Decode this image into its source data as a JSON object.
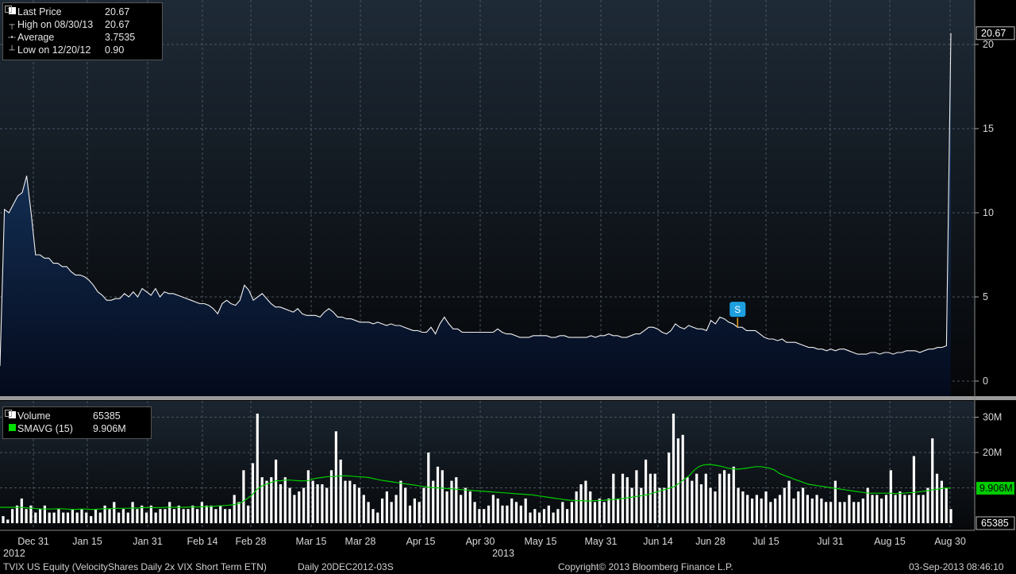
{
  "chart_data": {
    "type": "area",
    "security": "TVIX US Equity (VelocityShares Daily 2x VIX Short Term ETN)",
    "period_info": "Daily 20DEC2012-03S",
    "copyright": "Copyright© 2013 Bloomberg Finance L.P.",
    "timestamp": "03-Sep-2013 08:46:10",
    "year_labels": [
      "2012",
      "2013"
    ],
    "x_tick_labels": [
      "Dec 31",
      "Jan 15",
      "Jan 31",
      "Feb 14",
      "Feb 28",
      "Mar 15",
      "Mar 28",
      "Apr 15",
      "Apr 30",
      "May 15",
      "May 31",
      "Jun 14",
      "Jun 28",
      "Jul 15",
      "Jul 31",
      "Aug 15",
      "Aug 30"
    ],
    "price_panel": {
      "ylim": [
        0,
        22
      ],
      "y_ticks": [
        "0",
        "5",
        "10",
        "15",
        "20"
      ],
      "last_price_tag": "20.67",
      "legend": [
        {
          "label": "Last Price",
          "value": "20.67",
          "symbol": "square"
        },
        {
          "label": "High on 08/30/13",
          "value": "20.67",
          "symbol": "high"
        },
        {
          "label": "Average",
          "value": "3.7535",
          "symbol": "avg"
        },
        {
          "label": "Low on 12/20/12",
          "value": "0.90",
          "symbol": "low"
        }
      ],
      "annotation": {
        "text": "S",
        "date_index": 166
      },
      "series": [
        {
          "name": "Last Price",
          "color": "#f0f0f0",
          "fill_top": "#1b3f6b",
          "values": [
            0.9,
            10.2,
            10.0,
            10.5,
            11.0,
            11.2,
            12.2,
            10.0,
            7.5,
            7.5,
            7.3,
            7.3,
            7.0,
            7.0,
            6.8,
            6.8,
            6.5,
            6.3,
            6.3,
            6.2,
            6.0,
            5.7,
            5.3,
            5.1,
            4.8,
            4.8,
            4.9,
            4.9,
            5.2,
            5.0,
            5.3,
            5.0,
            5.5,
            5.3,
            5.1,
            5.5,
            5.0,
            5.3,
            5.2,
            5.2,
            5.1,
            5.0,
            4.9,
            4.8,
            4.7,
            4.6,
            4.6,
            4.5,
            4.3,
            4.0,
            4.6,
            4.8,
            4.6,
            4.5,
            4.8,
            5.7,
            5.4,
            4.8,
            5.0,
            5.2,
            4.9,
            4.6,
            4.4,
            4.4,
            4.3,
            4.2,
            4.1,
            4.3,
            4.0,
            3.9,
            3.9,
            3.9,
            3.8,
            4.1,
            4.3,
            4.1,
            3.8,
            3.8,
            3.7,
            3.7,
            3.6,
            3.5,
            3.5,
            3.5,
            3.4,
            3.5,
            3.4,
            3.3,
            3.4,
            3.3,
            3.3,
            3.2,
            3.1,
            3.0,
            3.0,
            2.9,
            2.9,
            3.2,
            2.8,
            3.4,
            3.8,
            3.4,
            3.1,
            3.1,
            2.9,
            2.9,
            2.9,
            2.9,
            2.9,
            2.9,
            2.9,
            2.9,
            3.1,
            2.9,
            2.8,
            2.8,
            2.7,
            2.6,
            2.6,
            2.6,
            2.7,
            2.7,
            2.7,
            2.7,
            2.6,
            2.6,
            2.7,
            2.7,
            2.6,
            2.6,
            2.6,
            2.6,
            2.6,
            2.7,
            2.6,
            2.7,
            2.7,
            2.8,
            2.7,
            2.7,
            2.6,
            2.6,
            2.7,
            2.8,
            2.8,
            3.0,
            3.2,
            3.2,
            3.1,
            2.9,
            2.8,
            3.0,
            3.4,
            3.2,
            3.1,
            3.3,
            3.2,
            3.1,
            3.1,
            3.0,
            3.6,
            3.4,
            3.8,
            3.7,
            3.5,
            3.4,
            3.2,
            3.2,
            3.0,
            3.0,
            3.0,
            2.8,
            2.6,
            2.5,
            2.5,
            2.4,
            2.5,
            2.3,
            2.3,
            2.3,
            2.2,
            2.1,
            2.0,
            2.0,
            1.9,
            1.9,
            1.8,
            1.9,
            1.8,
            1.9,
            1.9,
            1.8,
            1.7,
            1.6,
            1.6,
            1.6,
            1.7,
            1.7,
            1.6,
            1.7,
            1.7,
            1.6,
            1.7,
            1.7,
            1.8,
            1.8,
            1.8,
            1.7,
            1.8,
            1.9,
            1.9,
            2.0,
            2.0,
            2.1,
            20.67
          ]
        }
      ]
    },
    "volume_panel": {
      "ylim": [
        0,
        32
      ],
      "unit": "M",
      "y_ticks": [
        "30M",
        "20M"
      ],
      "sma_tag": "9.906M",
      "volume_tag": "65385",
      "legend": [
        {
          "label": "Volume",
          "value": "65385",
          "color": "#ffffff"
        },
        {
          "label": "SMAVG (15)",
          "value": "9.906M",
          "color": "#00dd00"
        }
      ],
      "series": [
        {
          "name": "Volume",
          "color": "#ffffff",
          "values": [
            2,
            1,
            4,
            5,
            7,
            4,
            5,
            3,
            4,
            5,
            3,
            3,
            4,
            3,
            3,
            4,
            3,
            4,
            3,
            2,
            4,
            3,
            5,
            4,
            6,
            3,
            4,
            3,
            6,
            4,
            5,
            3,
            5,
            3,
            4,
            4,
            6,
            4,
            5,
            4,
            4,
            5,
            4,
            6,
            5,
            5,
            4,
            5,
            4,
            4,
            8,
            6,
            15,
            5,
            17,
            31,
            13,
            12,
            13,
            18,
            11,
            13,
            10,
            8,
            9,
            10,
            15,
            12,
            11,
            11,
            10,
            15,
            26,
            18,
            12,
            12,
            11,
            10,
            8,
            6,
            4,
            3,
            7,
            9,
            6,
            8,
            12,
            10,
            5,
            7,
            6,
            10,
            20,
            12,
            16,
            15,
            9,
            12,
            13,
            8,
            10,
            9,
            6,
            4,
            4,
            5,
            8,
            7,
            5,
            5,
            7,
            6,
            5,
            7,
            3,
            4,
            3,
            4,
            5,
            3,
            4,
            6,
            4,
            6,
            9,
            11,
            12,
            9,
            6,
            7,
            6,
            7,
            14,
            7,
            14,
            13,
            10,
            15,
            10,
            18,
            14,
            14,
            10,
            10,
            20,
            31,
            24,
            25,
            13,
            12,
            14,
            11,
            14,
            10,
            9,
            14,
            15,
            14,
            16,
            10,
            9,
            8,
            7,
            8,
            7,
            9,
            6,
            7,
            8,
            10,
            12,
            7,
            9,
            10,
            8,
            7,
            8,
            7,
            6,
            6,
            12,
            6,
            6,
            8,
            6,
            6,
            7,
            10,
            8,
            8,
            7,
            8,
            15,
            8,
            9,
            8,
            8,
            19,
            8,
            8,
            10,
            24,
            14,
            12,
            10,
            4
          ]
        },
        {
          "name": "SMAVG (15)",
          "color": "#00cc00",
          "values": [
            4.5,
            4.5,
            4.5,
            4.5,
            4.5,
            4.4,
            4.3,
            4.2,
            4.1,
            4.0,
            4.0,
            4.0,
            4.1,
            4.1,
            4.0,
            3.9,
            3.9,
            4.0,
            4.0,
            3.9,
            3.9,
            4.0,
            4.1,
            4.1,
            4.2,
            4.2,
            4.2,
            4.2,
            4.3,
            4.3,
            4.4,
            4.4,
            4.4,
            4.4,
            4.4,
            4.5,
            4.5,
            4.5,
            4.5,
            4.5,
            4.6,
            4.6,
            4.6,
            4.7,
            4.7,
            4.8,
            4.9,
            5.0,
            5.1,
            5.2,
            5.5,
            6.0,
            7.0,
            8.0,
            9.5,
            10.5,
            11.0,
            11.5,
            12.0,
            12.0,
            12.2,
            12.2,
            12.1,
            12.0,
            12.0,
            12.1,
            12.6,
            12.8,
            13.0,
            13.2,
            13.2,
            13.3,
            13.4,
            13.4,
            13.3,
            13.2,
            13.1,
            13.0,
            12.8,
            12.5,
            12.2,
            12.0,
            11.8,
            11.6,
            11.4,
            11.2,
            11.0,
            10.8,
            10.6,
            10.4,
            10.2,
            10.1,
            10.0,
            9.9,
            9.8,
            9.7,
            9.6,
            9.5,
            9.4,
            9.3,
            9.2,
            9.1,
            9.0,
            8.9,
            8.8,
            8.7,
            8.6,
            8.5,
            8.4,
            8.3,
            8.2,
            8.1,
            8.0,
            7.8,
            7.6,
            7.4,
            7.2,
            7.0,
            6.8,
            6.6,
            6.5,
            6.4,
            6.4,
            6.3,
            6.3,
            6.4,
            6.4,
            6.5,
            6.6,
            6.7,
            6.8,
            7.0,
            7.2,
            7.4,
            7.6,
            7.8,
            8.0,
            8.4,
            8.8,
            9.2,
            9.6,
            10.0,
            10.5,
            11.5,
            12.5,
            13.5,
            15.0,
            16.0,
            16.5,
            16.6,
            16.5,
            16.3,
            16.0,
            15.6,
            15.4,
            15.3,
            15.4,
            15.6,
            15.8,
            16.0,
            16.0,
            15.8,
            15.5,
            15.0,
            14.0,
            13.5,
            13.0,
            12.5,
            12.0,
            11.5,
            11.0,
            10.8,
            10.6,
            10.4,
            10.2,
            10.0,
            9.8,
            9.6,
            9.4,
            9.2,
            9.0,
            8.8,
            8.6,
            8.5,
            8.5,
            8.5,
            8.5,
            8.5,
            8.4,
            8.4,
            8.5,
            8.6,
            8.7,
            8.8,
            9.0,
            9.2,
            9.4,
            9.6,
            9.8,
            10.0,
            9.906
          ]
        }
      ]
    }
  }
}
